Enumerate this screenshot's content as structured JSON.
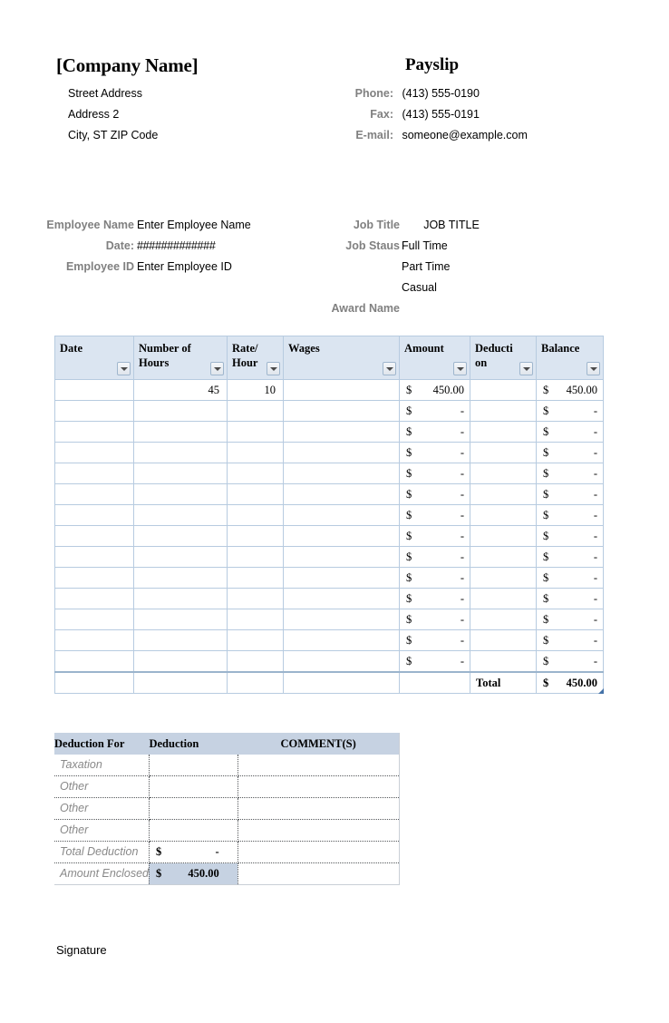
{
  "header": {
    "company_name": "[Company Name]",
    "doc_title": "Payslip",
    "address_lines": [
      "Street Address",
      "Address 2",
      "City, ST  ZIP Code"
    ],
    "contacts": [
      {
        "label": "Phone:",
        "value": "(413) 555-0190"
      },
      {
        "label": "Fax:",
        "value": "(413) 555-0191"
      },
      {
        "label": "E-mail:",
        "value": "someone@example.com"
      }
    ]
  },
  "employee_info": {
    "name_label": "Employee Name",
    "name_value": "Enter Employee Name",
    "date_label": "Date:",
    "date_value": "#############",
    "id_label": "Employee ID",
    "id_value": "Enter Employee ID"
  },
  "job_info": {
    "title_label": "Job Title",
    "title_value": "JOB TITLE",
    "status_label": "Job Staus",
    "status_options": [
      "Full Time",
      "Part Time",
      "Casual"
    ],
    "award_name_label": "Award Name"
  },
  "timesheet": {
    "columns": [
      "Date",
      "Number of Hours",
      "Rate/Hour",
      "Wages",
      "Amount",
      "Deduction",
      "Balance"
    ],
    "rows": [
      {
        "date": "",
        "hours": "45",
        "rate": "10",
        "wages": "",
        "amount_cur": "$",
        "amount": "450.00",
        "deduction": "",
        "balance_cur": "$",
        "balance": "450.00"
      },
      {
        "date": "",
        "hours": "",
        "rate": "",
        "wages": "",
        "amount_cur": "$",
        "amount": "-",
        "deduction": "",
        "balance_cur": "$",
        "balance": "-"
      },
      {
        "date": "",
        "hours": "",
        "rate": "",
        "wages": "",
        "amount_cur": "$",
        "amount": "-",
        "deduction": "",
        "balance_cur": "$",
        "balance": "-"
      },
      {
        "date": "",
        "hours": "",
        "rate": "",
        "wages": "",
        "amount_cur": "$",
        "amount": "-",
        "deduction": "",
        "balance_cur": "$",
        "balance": "-"
      },
      {
        "date": "",
        "hours": "",
        "rate": "",
        "wages": "",
        "amount_cur": "$",
        "amount": "-",
        "deduction": "",
        "balance_cur": "$",
        "balance": "-"
      },
      {
        "date": "",
        "hours": "",
        "rate": "",
        "wages": "",
        "amount_cur": "$",
        "amount": "-",
        "deduction": "",
        "balance_cur": "$",
        "balance": "-"
      },
      {
        "date": "",
        "hours": "",
        "rate": "",
        "wages": "",
        "amount_cur": "$",
        "amount": "-",
        "deduction": "",
        "balance_cur": "$",
        "balance": "-"
      },
      {
        "date": "",
        "hours": "",
        "rate": "",
        "wages": "",
        "amount_cur": "$",
        "amount": "-",
        "deduction": "",
        "balance_cur": "$",
        "balance": "-"
      },
      {
        "date": "",
        "hours": "",
        "rate": "",
        "wages": "",
        "amount_cur": "$",
        "amount": "-",
        "deduction": "",
        "balance_cur": "$",
        "balance": "-"
      },
      {
        "date": "",
        "hours": "",
        "rate": "",
        "wages": "",
        "amount_cur": "$",
        "amount": "-",
        "deduction": "",
        "balance_cur": "$",
        "balance": "-"
      },
      {
        "date": "",
        "hours": "",
        "rate": "",
        "wages": "",
        "amount_cur": "$",
        "amount": "-",
        "deduction": "",
        "balance_cur": "$",
        "balance": "-"
      },
      {
        "date": "",
        "hours": "",
        "rate": "",
        "wages": "",
        "amount_cur": "$",
        "amount": "-",
        "deduction": "",
        "balance_cur": "$",
        "balance": "-"
      },
      {
        "date": "",
        "hours": "",
        "rate": "",
        "wages": "",
        "amount_cur": "$",
        "amount": "-",
        "deduction": "",
        "balance_cur": "$",
        "balance": "-"
      },
      {
        "date": "",
        "hours": "",
        "rate": "",
        "wages": "",
        "amount_cur": "$",
        "amount": "-",
        "deduction": "",
        "balance_cur": "$",
        "balance": "-"
      }
    ],
    "total": {
      "label": "Total",
      "currency": "$",
      "value": "450.00"
    }
  },
  "deductions": {
    "columns": [
      "Deduction For",
      "Deduction",
      "COMMENT(S)"
    ],
    "rows": [
      {
        "label": "Taxation",
        "currency": "",
        "value": "",
        "comment": ""
      },
      {
        "label": "Other",
        "currency": "",
        "value": "",
        "comment": ""
      },
      {
        "label": "Other",
        "currency": "",
        "value": "",
        "comment": ""
      },
      {
        "label": "Other",
        "currency": "",
        "value": "",
        "comment": ""
      },
      {
        "label": "Total Deduction",
        "currency": "$",
        "value": "-",
        "comment": ""
      },
      {
        "label": "Amount Enclosed",
        "currency": "$",
        "value": "450.00",
        "comment": ""
      }
    ]
  },
  "footer": {
    "signature_label": "Signature"
  },
  "colors": {
    "label_gray": "#808080",
    "main_header_fill": "#dbe5f1",
    "deduction_header_fill": "#c6d2e2",
    "table_border": "#b7cbe0",
    "resize_handle": "#4472a8"
  },
  "chart_data": {
    "type": "table",
    "title": "Payslip",
    "columns": [
      "Date",
      "Number of Hours",
      "Rate/Hour",
      "Wages",
      "Amount",
      "Deduction",
      "Balance"
    ],
    "values": [
      [
        "",
        45,
        10,
        "",
        450.0,
        "",
        450.0
      ]
    ],
    "empty_row_count": 13,
    "total_balance": 450.0,
    "total_deduction": 0,
    "amount_enclosed": 450.0
  }
}
